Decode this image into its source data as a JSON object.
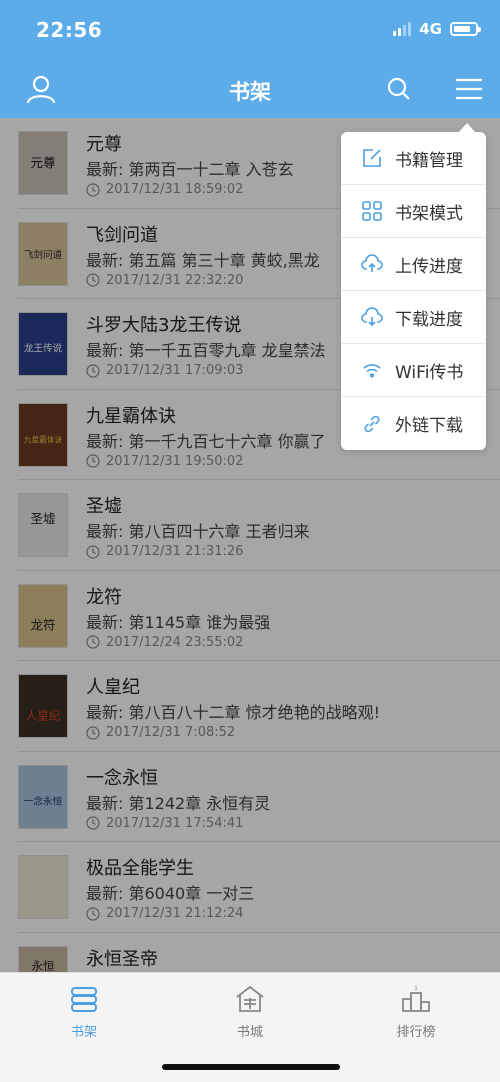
{
  "status_bar": {
    "time": "22:56",
    "network": "4G"
  },
  "header": {
    "title": "书架"
  },
  "books": [
    {
      "title": "元尊",
      "latest": "最新: 第两百一十二章 入苍玄",
      "time": "2017/12/31 18:59:02",
      "cover_color": "#c9c4b8",
      "cover_text": "元尊"
    },
    {
      "title": "飞剑问道",
      "latest": "最新: 第五篇 第三十章 黄蛟,黑龙",
      "time": "2017/12/31 22:32:20",
      "cover_color": "#d7c39a",
      "cover_text": "飞剑问道"
    },
    {
      "title": "斗罗大陆3龙王传说",
      "latest": "最新: 第一千五百零九章 龙皇禁法",
      "time": "2017/12/31 17:09:03",
      "cover_color": "#2b3f8c",
      "cover_text": "龙王传说"
    },
    {
      "title": "九星霸体诀",
      "latest": "最新: 第一千九百七十六章 你赢了",
      "time": "2017/12/31 19:50:02",
      "cover_color": "#6b3a22",
      "cover_text": "九星霸体诀"
    },
    {
      "title": "圣墟",
      "latest": "最新: 第八百四十六章 王者归来",
      "time": "2017/12/31 21:31:26",
      "cover_color": "#e8e8e8",
      "cover_text": "圣墟"
    },
    {
      "title": "龙符",
      "latest": "最新: 第1145章 谁为最强",
      "time": "2017/12/24 23:55:02",
      "cover_color": "#d9c28c",
      "cover_text": "龙符"
    },
    {
      "title": "人皇纪",
      "latest": "最新: 第八百八十二章 惊才绝艳的战略观!",
      "time": "2017/12/31 7:08:52",
      "cover_color": "#3a3126",
      "cover_text": "人皇纪"
    },
    {
      "title": "一念永恒",
      "latest": "最新: 第1242章 永恒有灵",
      "time": "2017/12/31 17:54:41",
      "cover_color": "#a9c4dc",
      "cover_text": "一念永恒"
    },
    {
      "title": "极品全能学生",
      "latest": "最新: 第6040章 一对三",
      "time": "2017/12/31 21:12:24",
      "cover_color": "#efe9d6",
      "cover_text": ""
    },
    {
      "title": "永恒圣帝",
      "latest": "",
      "time": "",
      "cover_color": "#c7b7a2",
      "cover_text": "永恒"
    }
  ],
  "popup_menu": [
    {
      "label": "书籍管理",
      "icon": "edit-icon"
    },
    {
      "label": "书架模式",
      "icon": "grid-icon"
    },
    {
      "label": "上传进度",
      "icon": "cloud-upload-icon"
    },
    {
      "label": "下载进度",
      "icon": "cloud-download-icon"
    },
    {
      "label": "WiFi传书",
      "icon": "wifi-icon"
    },
    {
      "label": "外链下载",
      "icon": "link-icon"
    }
  ],
  "tabs": [
    {
      "label": "书架",
      "icon": "bookshelf-icon",
      "active": true
    },
    {
      "label": "书城",
      "icon": "bookstore-icon",
      "active": false
    },
    {
      "label": "排行榜",
      "icon": "ranking-icon",
      "active": false
    }
  ],
  "colors": {
    "primary": "#5BACE8",
    "accent": "#4E9FE0"
  }
}
